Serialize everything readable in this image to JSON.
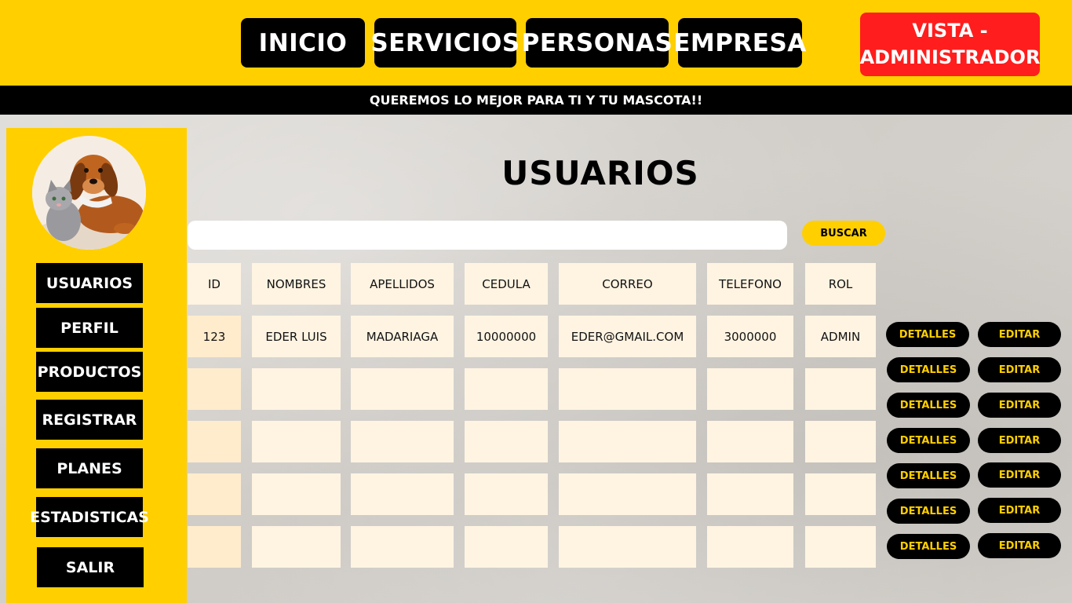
{
  "nav": {
    "items": [
      "INICIO",
      "SERVICIOS",
      "PERSONAS",
      "EMPRESA"
    ],
    "admin_label": "VISTA - ADMINISTRADOR"
  },
  "tagline": "QUEREMOS LO MEJOR PARA TI Y TU MASCOTA!!",
  "sidebar": {
    "avatar": "pets-photo",
    "items": [
      "USUARIOS",
      "PERFIL",
      "PRODUCTOS",
      "REGISTRAR",
      "PLANES",
      "ESTADISTICAS",
      "SALIR"
    ]
  },
  "main": {
    "title": "USUARIOS",
    "search": {
      "placeholder": "",
      "value": "",
      "button_label": "BUSCAR"
    },
    "table": {
      "columns": [
        "ID",
        "NOMBRES",
        "APELLIDOS",
        "CEDULA",
        "CORREO",
        "TELEFONO",
        "ROL"
      ],
      "rows": [
        [
          "123",
          "EDER LUIS",
          "MADARIAGA",
          "10000000",
          "EDER@GMAIL.COM",
          "3000000",
          "ADMIN"
        ],
        [
          "",
          "",
          "",
          "",
          "",
          "",
          ""
        ],
        [
          "",
          "",
          "",
          "",
          "",
          "",
          ""
        ],
        [
          "",
          "",
          "",
          "",
          "",
          "",
          ""
        ],
        [
          "",
          "",
          "",
          "",
          "",
          "",
          ""
        ]
      ]
    },
    "actions": {
      "details_label": "DETALLES",
      "edit_label": "EDITAR",
      "rows": 7
    }
  },
  "colors": {
    "primary": "#ffcf00",
    "dark": "#000000",
    "danger": "#ff1d1d",
    "cell": "#fff4e2"
  }
}
